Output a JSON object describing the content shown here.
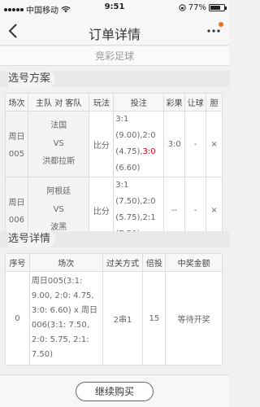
{
  "status": {
    "carrier": "中国移动",
    "time": "9:51",
    "battery": "77%",
    "battery_level": 0.77
  },
  "nav": {
    "title": "订单详情"
  },
  "subtitle": "竞彩足球",
  "scheme": {
    "title": "选号方案",
    "headers": [
      "场次",
      "主队 对 客队",
      "玩法",
      "投注",
      "彩果",
      "让球",
      "胆"
    ],
    "rows": [
      {
        "match_line1": "周日",
        "match_line2": "005",
        "home": "法国",
        "vs": "VS",
        "away": "洪都拉斯",
        "play": "比分",
        "bet_prefix": "3:1 (9.00),2:0 (4.75),",
        "bet_hit": "3:0",
        "bet_suffix": " (6.60)",
        "result": "3:0",
        "handicap": "-",
        "banker": "×"
      },
      {
        "match_line1": "周日",
        "match_line2": "006",
        "home": "阿根廷",
        "vs": "VS",
        "away": "波黑",
        "play": "比分",
        "bet_prefix": "3:1 (7.50),2:0 (5.75),2:1 (7.50)",
        "bet_hit": "",
        "bet_suffix": "",
        "result": "--",
        "handicap": "-",
        "banker": "×"
      }
    ]
  },
  "detail": {
    "title": "选号详情",
    "headers": [
      "序号",
      "场次",
      "过关方式",
      "倍投",
      "中奖金额"
    ],
    "rows": [
      {
        "index": "0",
        "matches": "周日005(3:1: 9.00, 2:0: 4.75, 3:0: 6.60) x 周日006(3:1: 7.50, 2:0: 5.75, 2:1: 7.50)",
        "pass_type": "2串1",
        "multiple": "15",
        "prize": "等待开奖"
      }
    ]
  },
  "footer": {
    "continue_label": "继续购买"
  },
  "colors": {
    "accent": "#f36c21",
    "hit": "#d0021b"
  },
  "icons": {
    "back": "chevron-left-icon",
    "more": "more-dots-icon",
    "wifi": "wifi-icon"
  }
}
